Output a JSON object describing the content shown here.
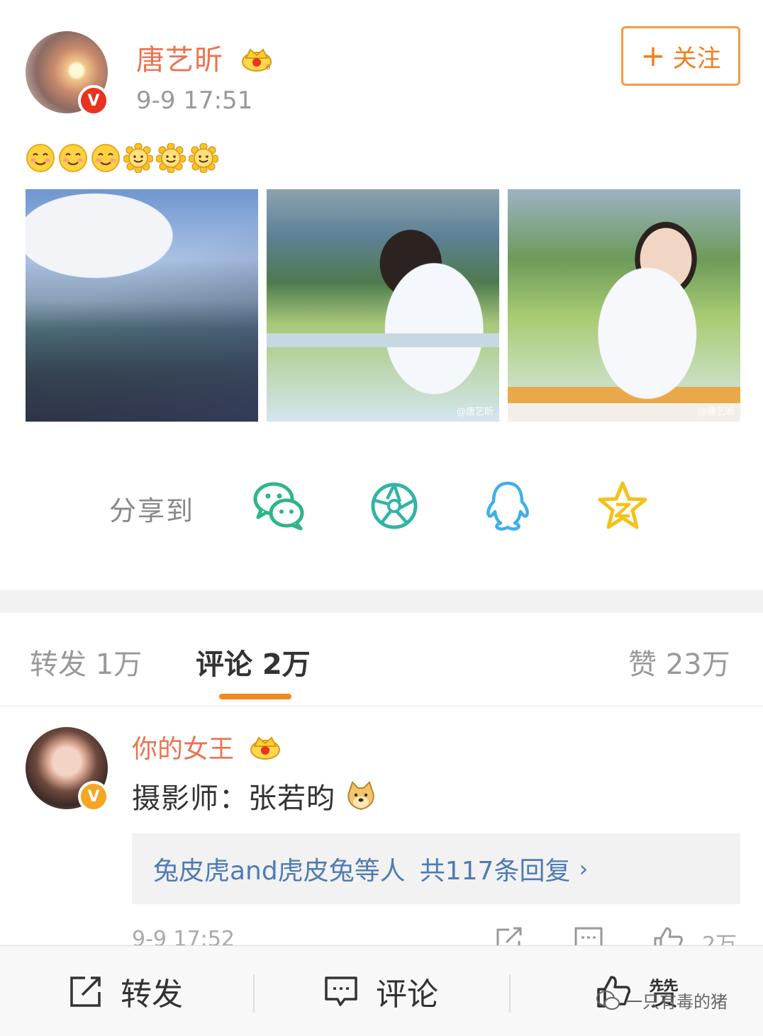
{
  "post": {
    "username": "唐艺昕",
    "time": "9-9 17:51",
    "follow_label": "关注",
    "emoji_names": [
      "smile-emoji",
      "smile-emoji",
      "smile-emoji",
      "sunflower-emoji",
      "sunflower-emoji",
      "sunflower-emoji"
    ],
    "photo_watermarks": [
      "",
      "@唐艺昕",
      "@唐艺昕"
    ]
  },
  "share": {
    "label": "分享到",
    "targets": [
      "wechat-icon",
      "moments-icon",
      "qq-icon",
      "qzone-icon"
    ],
    "colors": {
      "wechat": "#2fb58a",
      "moments": "#2fb5a6",
      "qq": "#3fb0e8",
      "qzone": "#f5c11a"
    }
  },
  "tabs": {
    "repost": "转发 1万",
    "comments": "评论 2万",
    "likes": "赞 23万"
  },
  "comment": {
    "username": "你的女王",
    "text": "摄影师：张若昀",
    "reply_users": "兔皮虎and虎皮兔等人",
    "reply_count": "共117条回复",
    "reply_arrow": "›",
    "time": "9-9 17:52",
    "like_count": "2万"
  },
  "toolbar": {
    "repost": "转发",
    "comment": "评论",
    "like": "赞"
  },
  "watermark": "一只有毒的猪",
  "colors": {
    "accent_orange": "#f5871f",
    "username_orange": "#eb7350",
    "link_blue": "#4f7bb5"
  }
}
